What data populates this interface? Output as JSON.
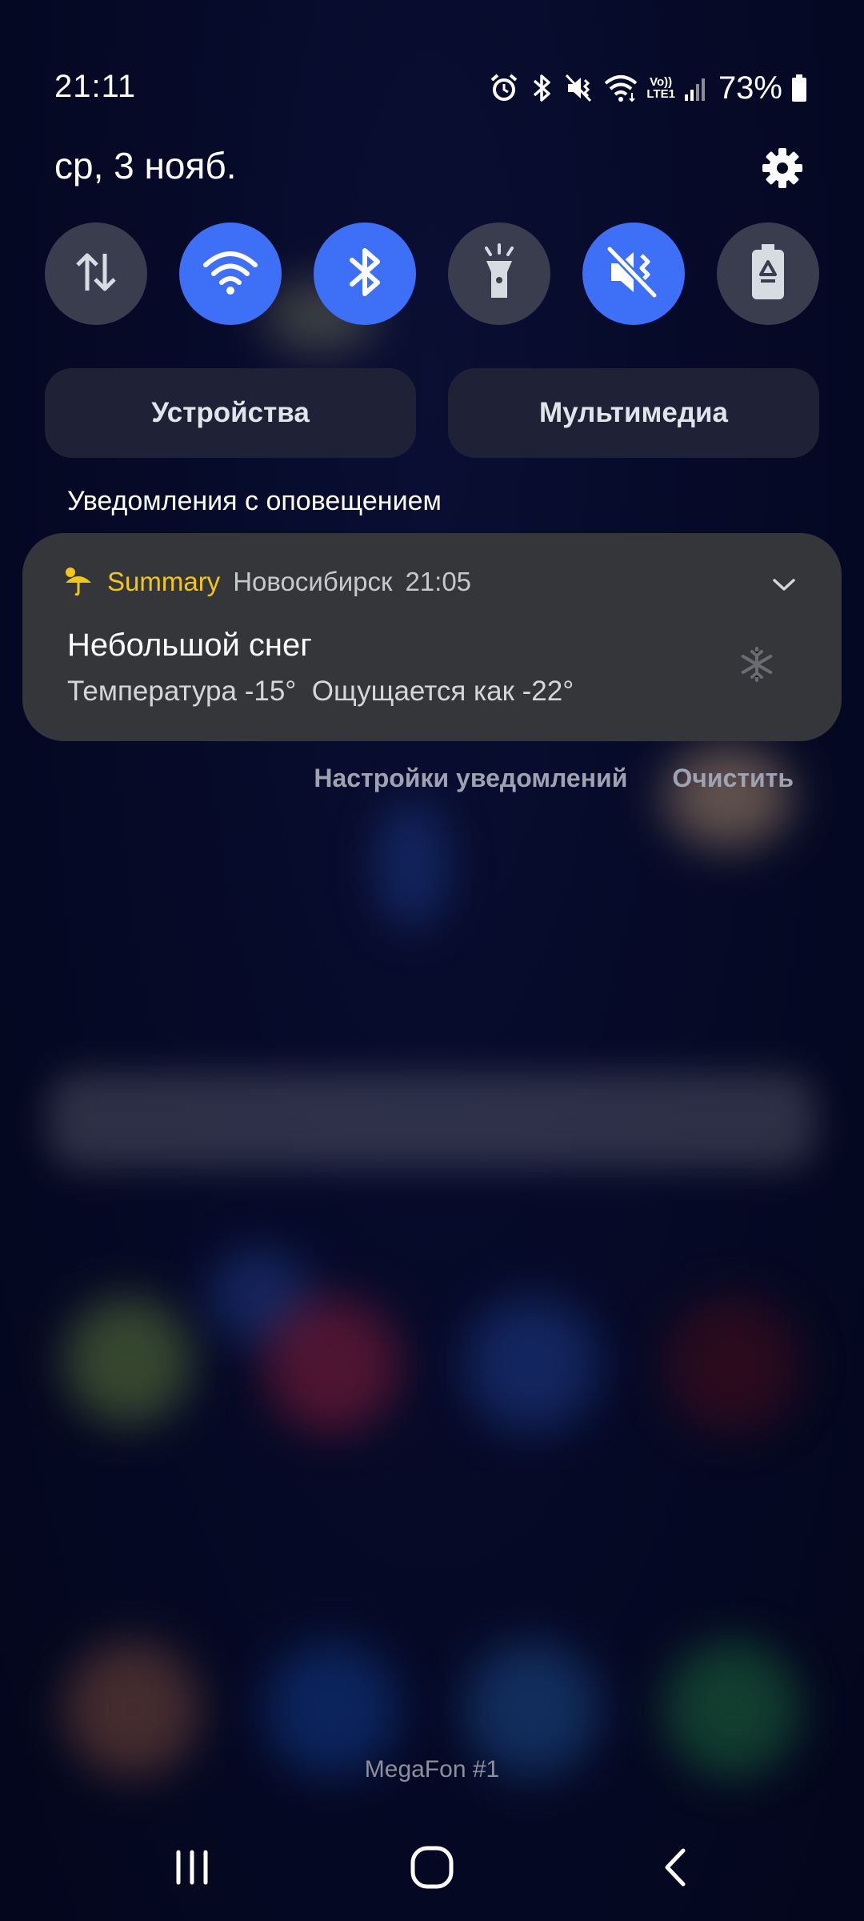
{
  "status_bar": {
    "time": "21:11",
    "battery_percent": "73%",
    "icons": [
      "alarm-icon",
      "bluetooth-icon",
      "vibrate-mute-icon",
      "wifi-icon",
      "volte-lte-icon",
      "signal-icon",
      "battery-icon"
    ],
    "volte_label_top": "Vo))",
    "volte_label_bottom": "LTE1"
  },
  "header": {
    "date": "ср, 3 нояб."
  },
  "quick_toggles": [
    {
      "name": "mobile-data",
      "icon": "data-transfer-icon",
      "active": false
    },
    {
      "name": "wifi",
      "icon": "wifi-icon",
      "active": true
    },
    {
      "name": "bluetooth",
      "icon": "bluetooth-icon",
      "active": true
    },
    {
      "name": "flashlight",
      "icon": "flashlight-icon",
      "active": false
    },
    {
      "name": "sound-mute",
      "icon": "mute-vibrate-icon",
      "active": true
    },
    {
      "name": "power-saving",
      "icon": "battery-recycle-icon",
      "active": false
    }
  ],
  "panels": {
    "devices_label": "Устройства",
    "media_label": "Мультимедиа"
  },
  "section_label": "Уведомления с оповещением",
  "notification": {
    "app": "Summary",
    "location": "Новосибирск",
    "time": "21:05",
    "title": "Небольшой снег",
    "text": "Температура -15°  Ощущается как -22°"
  },
  "actions": {
    "settings_label": "Настройки уведомлений",
    "clear_label": "Очистить"
  },
  "carrier": "MegaFon #1",
  "colors": {
    "accent": "#3e6ff7",
    "app_name": "#f2c717",
    "background": "#050823"
  }
}
